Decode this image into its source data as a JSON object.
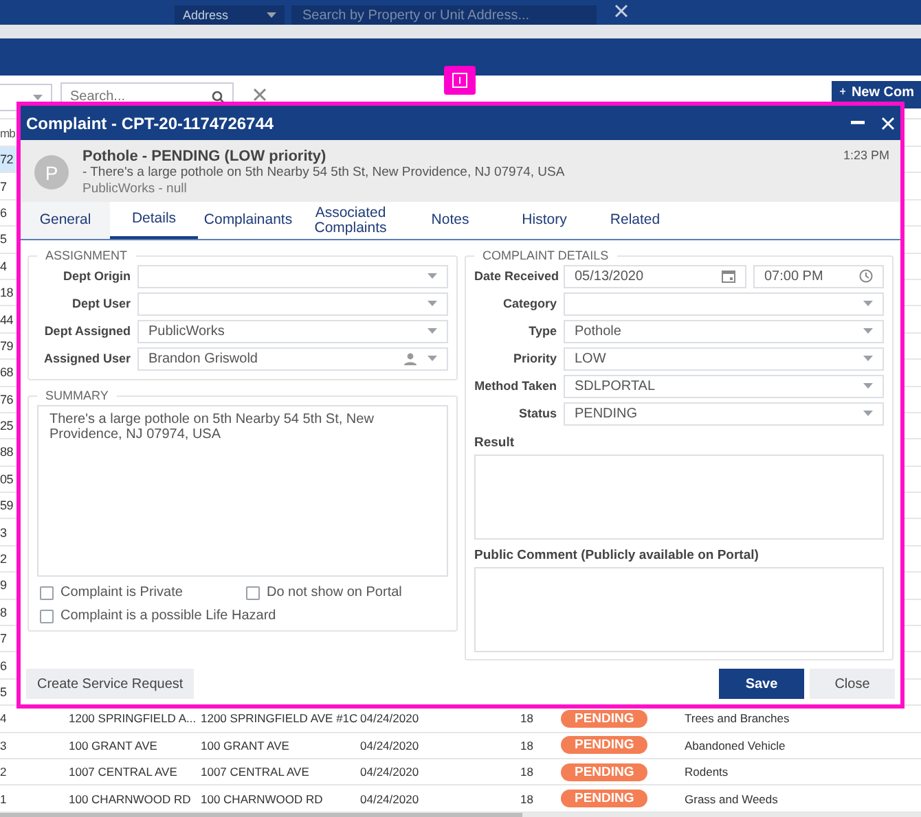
{
  "top_bar": {
    "address_select": "Address",
    "search_placeholder": "Search by Property or Unit Address..."
  },
  "toolbar": {
    "search_placeholder": "Search...",
    "new_button": "New Com"
  },
  "table": {
    "header_fragment": "mb",
    "row_fragments": [
      {
        "text": "72",
        "selected": true
      },
      {
        "text": "7",
        "selected": false
      },
      {
        "text": "6",
        "selected": false
      },
      {
        "text": "5",
        "selected": false
      },
      {
        "text": "4",
        "selected": false
      },
      {
        "text": "18",
        "selected": false
      },
      {
        "text": "44",
        "selected": false
      },
      {
        "text": "79",
        "selected": false
      },
      {
        "text": "68",
        "selected": false
      },
      {
        "text": "76",
        "selected": false
      },
      {
        "text": "25",
        "selected": false
      },
      {
        "text": "88",
        "selected": false
      },
      {
        "text": "05",
        "selected": false
      },
      {
        "text": "59",
        "selected": false
      },
      {
        "text": "3",
        "selected": false
      },
      {
        "text": "2",
        "selected": false
      },
      {
        "text": "9",
        "selected": false
      },
      {
        "text": "8",
        "selected": false
      },
      {
        "text": "7",
        "selected": false
      },
      {
        "text": "6",
        "selected": false
      },
      {
        "text": "5",
        "selected": false
      }
    ],
    "rows": [
      {
        "number": "4",
        "address": "1200 SPRINGFIELD A...",
        "unit_address": "1200 SPRINGFIELD AVE #1C",
        "date": "04/24/2020",
        "count": "18",
        "status": "PENDING",
        "category": "Trees and Branches"
      },
      {
        "number": "3",
        "address": "100 GRANT AVE",
        "unit_address": "100 GRANT AVE",
        "date": "04/24/2020",
        "count": "18",
        "status": "PENDING",
        "category": "Abandoned Vehicle"
      },
      {
        "number": "2",
        "address": "1007 CENTRAL AVE",
        "unit_address": "1007 CENTRAL AVE",
        "date": "04/24/2020",
        "count": "18",
        "status": "PENDING",
        "category": "Rodents"
      },
      {
        "number": "1",
        "address": "100 CHARNWOOD RD",
        "unit_address": "100 CHARNWOOD RD",
        "date": "04/24/2020",
        "count": "18",
        "status": "PENDING",
        "category": "Grass and Weeds"
      }
    ]
  },
  "dialog": {
    "title": "Complaint - CPT-20-1174726744",
    "avatar_letter": "P",
    "subject": "Pothole - PENDING (LOW priority)",
    "description": "- There's a large pothole on 5th Nearby 54 5th St, New Providence, NJ 07974, USA",
    "meta": "PublicWorks - null",
    "time": "1:23 PM",
    "tabs": [
      {
        "label": "General",
        "selected": false
      },
      {
        "label": "Details",
        "selected": true
      },
      {
        "label": "Complainants",
        "selected": false
      },
      {
        "label": "Associated Complaints",
        "selected": false
      },
      {
        "label": "Notes",
        "selected": false
      },
      {
        "label": "History",
        "selected": false
      },
      {
        "label": "Related",
        "selected": false
      }
    ],
    "assignment": {
      "title": "ASSIGNMENT",
      "fields": [
        {
          "label": "Dept Origin",
          "kind": "select"
        },
        {
          "label": "Dept User",
          "kind": "select"
        },
        {
          "label": "Dept Assigned",
          "value": "PublicWorks",
          "kind": "select"
        },
        {
          "label": "Assigned User",
          "value": "Brandon Griswold",
          "kind": "user"
        }
      ]
    },
    "summary": {
      "title": "SUMMARY",
      "text": "There's a large pothole on 5th Nearby 54 5th St, New Providence, NJ 07974, USA",
      "checkboxes": [
        {
          "label": "Complaint is Private",
          "checked": false
        },
        {
          "label": "Do not show on Portal",
          "checked": false
        },
        {
          "label": "Complaint is a possible Life Hazard",
          "checked": false
        }
      ]
    },
    "details": {
      "title": "COMPLAINT DETAILS",
      "date_label": "Date Received",
      "date": "05/13/2020",
      "time": "07:00 PM",
      "fields": [
        {
          "label": "Category"
        },
        {
          "label": "Type",
          "value": "Pothole"
        },
        {
          "label": "Priority",
          "value": "LOW"
        },
        {
          "label": "Method Taken",
          "value": "SDLPORTAL"
        },
        {
          "label": "Status",
          "value": "PENDING"
        }
      ],
      "result_label": "Result",
      "comment_label": "Public Comment (Publicly available on Portal)"
    },
    "footer": {
      "service_button": "Create Service Request",
      "save_button": "Save",
      "close_button": "Close"
    }
  }
}
